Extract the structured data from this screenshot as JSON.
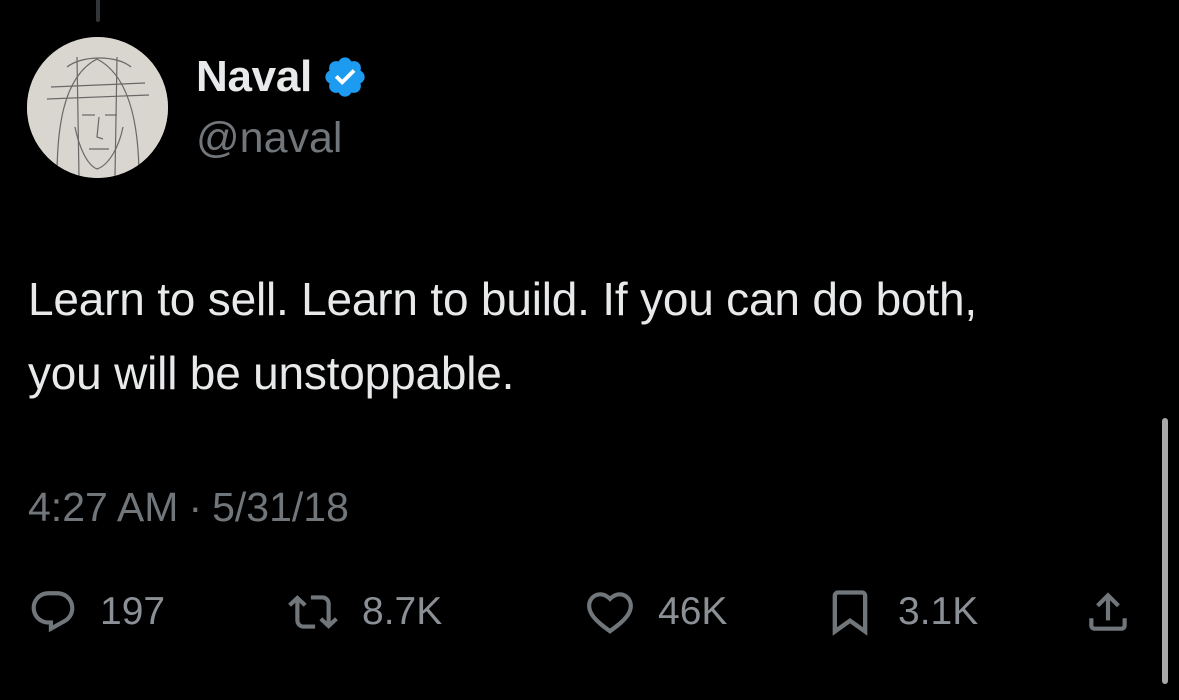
{
  "author": {
    "display_name": "Naval",
    "handle": "@naval",
    "verified": true,
    "verified_color": "#1d9bf0"
  },
  "tweet": {
    "text": "Learn to sell. Learn to build. If you can do both,\nyou will be unstoppable.",
    "time": "4:27 AM",
    "separator": "·",
    "date": "5/31/18"
  },
  "actions": {
    "replies": {
      "icon": "reply-icon",
      "count": "197"
    },
    "reposts": {
      "icon": "repost-icon",
      "count": "8.7K"
    },
    "likes": {
      "icon": "heart-icon",
      "count": "46K"
    },
    "bookmarks": {
      "icon": "bookmark-icon",
      "count": "3.1K"
    },
    "share": {
      "icon": "share-icon"
    }
  },
  "colors": {
    "background": "#000000",
    "text": "#e7e9ea",
    "secondary_text": "#71767b"
  }
}
